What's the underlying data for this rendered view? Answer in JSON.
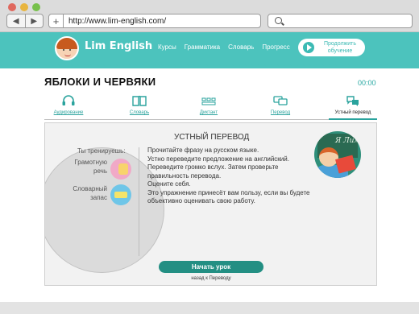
{
  "browser": {
    "url": "http://www.lim-english.com/",
    "back_glyph": "◀",
    "forward_glyph": "▶",
    "new_tab_glyph": "+"
  },
  "site": {
    "logo_text": "Lim English",
    "nav": [
      "Курсы",
      "Грамматика",
      "Словарь",
      "Прогресс"
    ],
    "continue_label": "Продолжить обучение",
    "accent_color": "#4cc3bd"
  },
  "lesson": {
    "title": "ЯБЛОКИ И ЧЕРВЯКИ",
    "timer": "00:00"
  },
  "tabs": [
    {
      "label": "Аудирование",
      "icon": "headphones-icon",
      "active": false
    },
    {
      "label": "Словарь",
      "icon": "book-icon",
      "active": false
    },
    {
      "label": "Диктант",
      "icon": "keyboard-icon",
      "active": false
    },
    {
      "label": "Перевод",
      "icon": "chat-icon",
      "active": false
    },
    {
      "label": "Устный перевод",
      "icon": "speech-bubbles-icon",
      "active": true
    }
  ],
  "panel": {
    "section_title": "УСТНЫЙ ПЕРЕВОД",
    "training_label": "Ты тренируешь:",
    "skills": [
      "Грамотную речь",
      "Словарный запас"
    ],
    "instructions": [
      "Прочитайте фразу на русском языке.",
      "Устно переведите предложение на английский.",
      "Переведите громко вслух. Затем проверьте правильность перевода.",
      "Оцените себя.",
      "Это упражнение принесёт вам пользу, если вы будете объективно оценивать свою работу."
    ],
    "illustration_text": "Я Лим",
    "start_button": "Начать урок",
    "back_link": "назад к Переводу"
  }
}
